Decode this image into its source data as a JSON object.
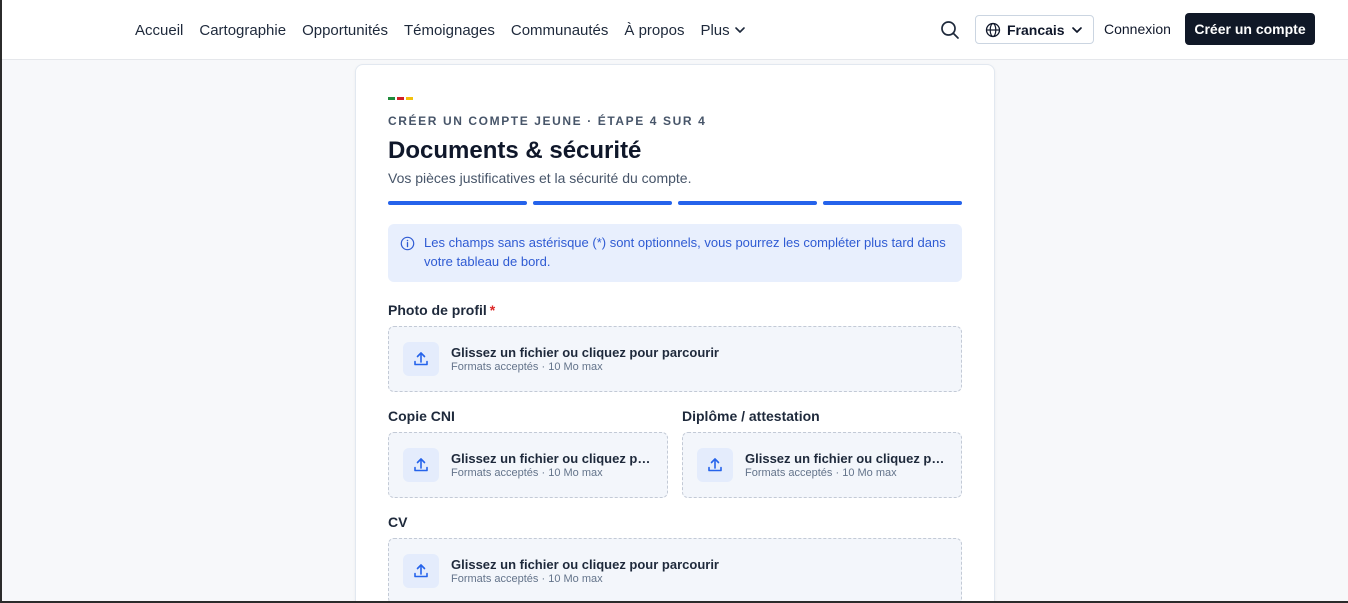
{
  "nav": {
    "items": [
      "Accueil",
      "Cartographie",
      "Opportunités",
      "Témoignages",
      "Communautés",
      "À propos",
      "Plus"
    ]
  },
  "header": {
    "language": "Francais",
    "login_label": "Connexion",
    "signup_label": "Créer un compte",
    "icons": [
      "search-icon",
      "globe-icon",
      "chevron-down-icon"
    ]
  },
  "form": {
    "eyebrow": "CRÉER UN COMPTE JEUNE · ÉTAPE 4 SUR 4",
    "title": "Documents & sécurité",
    "subtitle": "Vos pièces justificatives et la sécurité du compte.",
    "progress": {
      "current_step": 4,
      "total_steps": 4
    },
    "flag_colors": [
      "#1f8a3b",
      "#d11f26",
      "#f3c10c"
    ],
    "accent_color": "#2563eb",
    "info_text": "Les champs sans astérisque (*) sont optionnels, vous pourrez les compléter plus tard dans votre tableau de bord.",
    "fields": {
      "photo": {
        "label": "Photo de profil",
        "required_mark": "*",
        "main": "Glissez un fichier ou cliquez pour parcourir",
        "sub": "Formats acceptés · 10 Mo max"
      },
      "cni": {
        "label": "Copie CNI",
        "main": "Glissez un fichier ou cliquez pour parcourir",
        "sub": "Formats acceptés · 10 Mo max"
      },
      "diplome": {
        "label": "Diplôme / attestation",
        "main": "Glissez un fichier ou cliquez pour parcourir",
        "sub": "Formats acceptés · 10 Mo max"
      },
      "cv": {
        "label": "CV",
        "main": "Glissez un fichier ou cliquez pour parcourir",
        "sub": "Formats acceptés · 10 Mo max"
      }
    }
  }
}
